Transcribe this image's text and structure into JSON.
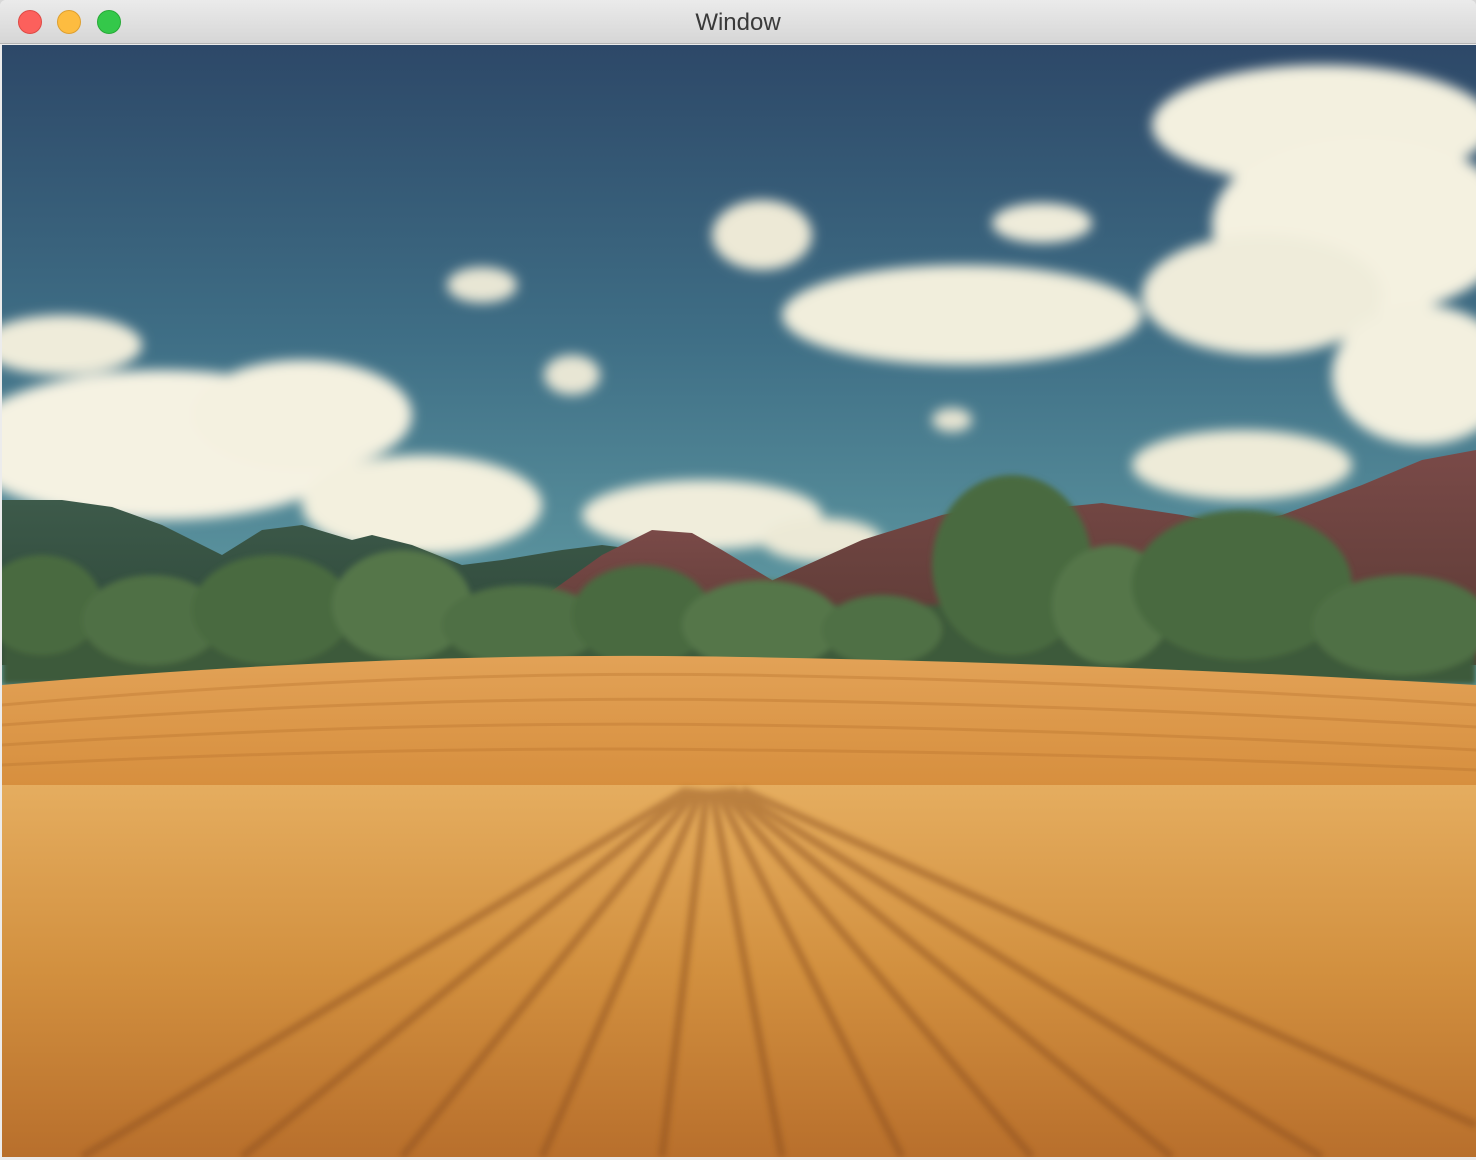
{
  "window": {
    "title": "Window"
  },
  "colors": {
    "close_button": "#fc605c",
    "minimize_button": "#fdbc40",
    "zoom_button": "#34c84a",
    "sky_top": "#2e4a6b",
    "sky_bottom": "#5a9aa6",
    "field": "#d8933e"
  },
  "content": {
    "image_subject": "landscape-photo"
  }
}
